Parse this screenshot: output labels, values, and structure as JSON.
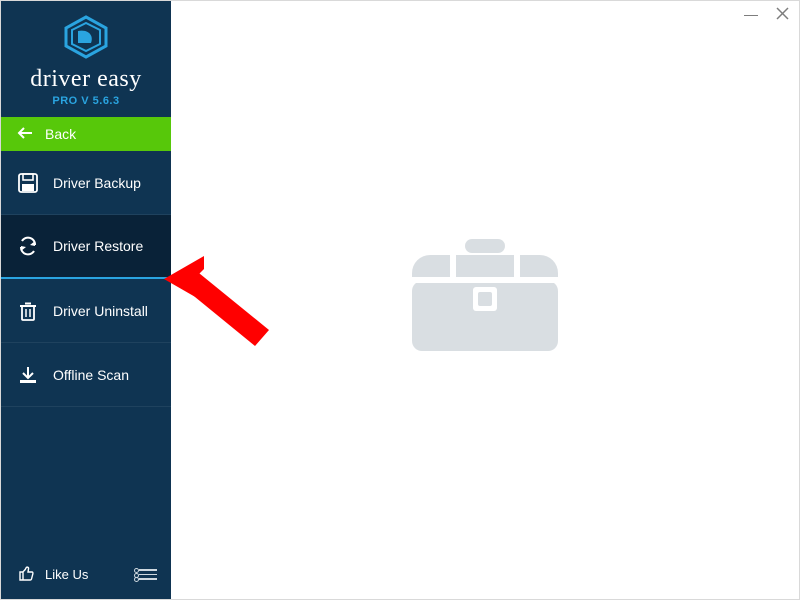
{
  "brand": {
    "name": "driver easy",
    "version_label": "PRO V 5.6.3"
  },
  "back": {
    "label": "Back"
  },
  "menu": {
    "items": [
      {
        "label": "Driver Backup",
        "icon": "save-icon",
        "active": false
      },
      {
        "label": "Driver Restore",
        "icon": "refresh-icon",
        "active": true
      },
      {
        "label": "Driver Uninstall",
        "icon": "trash-icon",
        "active": false
      },
      {
        "label": "Offline Scan",
        "icon": "download-icon",
        "active": false
      }
    ]
  },
  "footer": {
    "like_label": "Like Us"
  },
  "colors": {
    "sidebar_bg": "#0f3452",
    "sidebar_active_bg": "#092238",
    "accent_blue": "#2aa4e0",
    "back_green": "#57c80a",
    "placeholder_gray": "#d8dde1"
  }
}
